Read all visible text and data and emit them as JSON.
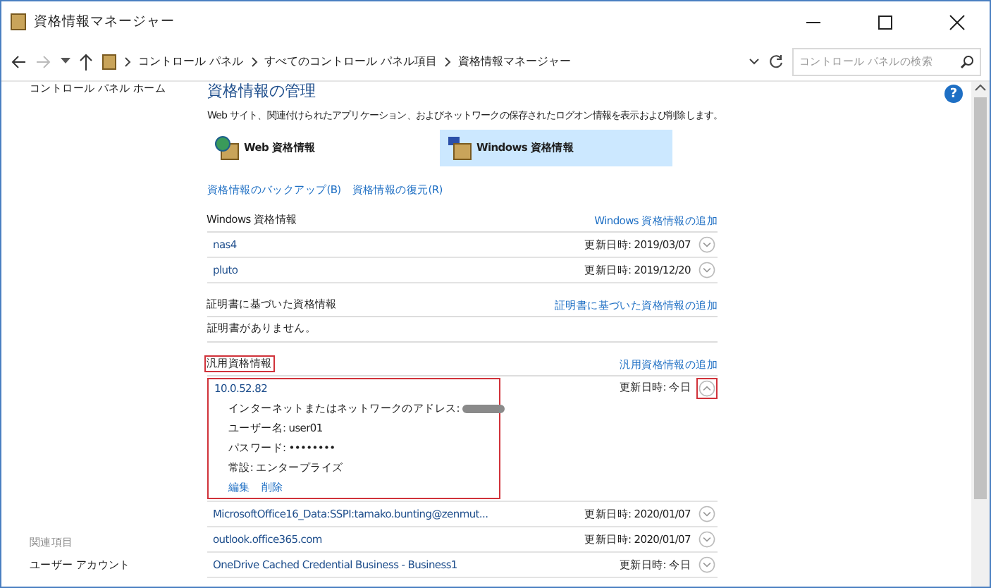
{
  "window": {
    "title": "資格情報マネージャー"
  },
  "address_bar": {
    "path": [
      "コントロール パネル",
      "すべてのコントロール パネル項目",
      "資格情報マネージャー"
    ],
    "search": {
      "placeholder": "コントロール パネルの検索"
    }
  },
  "help": "?",
  "sidebar": {
    "home_link": "コントロール パネル ホーム",
    "see_also_heading": "関連項目",
    "see_also_links": [
      "ユーザー アカウント"
    ]
  },
  "main": {
    "heading": "資格情報の管理",
    "description": "Web サイト、関連付けられたアプリケーション、およびネットワークの保存されたログオン情報を表示および削除します。",
    "vault_tabs": [
      {
        "label": "Web 資格情報",
        "kind": "web",
        "selected": false
      },
      {
        "label": "Windows 資格情報",
        "kind": "windows",
        "selected": true
      }
    ],
    "actions": [
      "資格情報のバックアップ(B)",
      "資格情報の復元(R)"
    ],
    "sections": [
      {
        "title": "Windows 資格情報",
        "add_link": "Windows 資格情報の追加",
        "highlighted": false,
        "items": [
          {
            "name": "nas4",
            "modified": "更新日時: 2019/03/07",
            "expanded": false,
            "highlighted": false
          },
          {
            "name": "pluto",
            "modified": "更新日時: 2019/12/20",
            "expanded": false,
            "highlighted": false
          }
        ]
      },
      {
        "title": "証明書に基づいた資格情報",
        "add_link": "証明書に基づいた資格情報の追加",
        "highlighted": false,
        "empty_text": "証明書がありません。"
      },
      {
        "title": "汎用資格情報",
        "add_link": "汎用資格情報の追加",
        "highlighted": true,
        "items": [
          {
            "name": "10.0.52.82",
            "modified": "更新日時: 今日",
            "expanded": true,
            "highlighted": true,
            "details": [
              {
                "kind": "redacted",
                "label": "インターネットまたはネットワークのアドレス:"
              },
              {
                "kind": "text",
                "label": "ユーザー名:",
                "value": "user01"
              },
              {
                "kind": "text",
                "label": "パスワード:",
                "value": "••••••••"
              },
              {
                "kind": "text",
                "label": "常設:",
                "value": "エンタープライズ"
              }
            ],
            "actions": [
              "編集",
              "削除"
            ]
          },
          {
            "name": "MicrosoftOffice16_Data:SSPI:tamako.bunting@zenmut...",
            "modified": "更新日時: 2020/01/07",
            "expanded": false,
            "highlighted": false
          },
          {
            "name": "outlook.office365.com",
            "modified": "更新日時: 2020/01/07",
            "expanded": false,
            "highlighted": false
          },
          {
            "name": "OneDrive Cached Credential Business - Business1",
            "modified": "更新日時: 今日",
            "expanded": false,
            "highlighted": false
          }
        ]
      }
    ]
  }
}
